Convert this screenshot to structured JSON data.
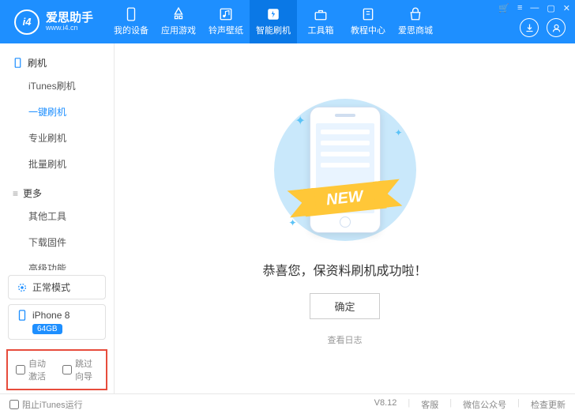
{
  "header": {
    "logo_initials": "i4",
    "logo_title": "爱思助手",
    "logo_sub": "www.i4.cn",
    "nav": [
      {
        "label": "我的设备",
        "icon": "phone"
      },
      {
        "label": "应用游戏",
        "icon": "apps"
      },
      {
        "label": "铃声壁纸",
        "icon": "music"
      },
      {
        "label": "智能刷机",
        "icon": "flash",
        "active": true
      },
      {
        "label": "工具箱",
        "icon": "toolbox"
      },
      {
        "label": "教程中心",
        "icon": "book"
      },
      {
        "label": "爱思商城",
        "icon": "shop"
      }
    ]
  },
  "sidebar": {
    "section1": "刷机",
    "items1": [
      {
        "label": "iTunes刷机"
      },
      {
        "label": "一键刷机",
        "active": true
      },
      {
        "label": "专业刷机"
      },
      {
        "label": "批量刷机"
      }
    ],
    "section2": "更多",
    "items2": [
      {
        "label": "其他工具"
      },
      {
        "label": "下载固件"
      },
      {
        "label": "高级功能"
      }
    ],
    "mode": "正常模式",
    "device_name": "iPhone 8",
    "device_badge": "64GB",
    "check_auto_activate": "自动激活",
    "check_skip_guide": "跳过向导"
  },
  "main": {
    "banner": "NEW",
    "success": "恭喜您，保资料刷机成功啦！",
    "ok": "确定",
    "log": "查看日志"
  },
  "footer": {
    "block_itunes": "阻止iTunes运行",
    "version": "V8.12",
    "support": "客服",
    "wechat": "微信公众号",
    "update": "检查更新"
  }
}
